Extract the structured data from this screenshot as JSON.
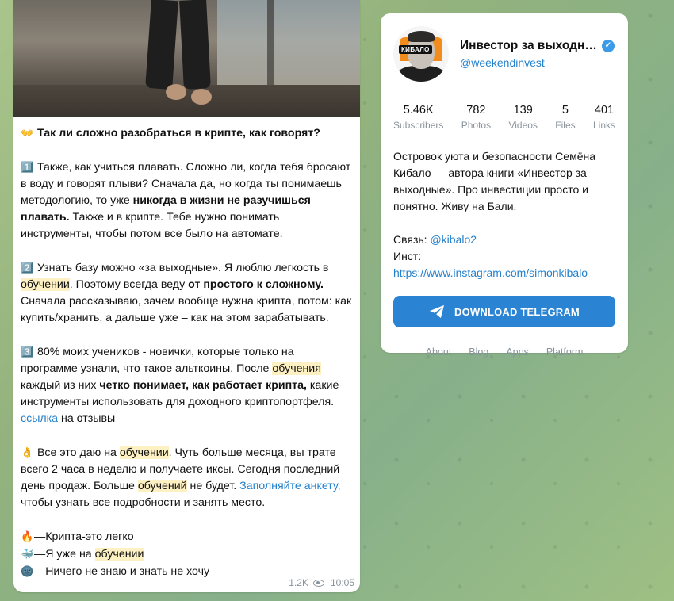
{
  "post": {
    "headline_emoji": "👐",
    "headline": "Так ли сложно разобраться в крипте, как говорят?",
    "p1_emoji": "1️⃣",
    "p1_a": "Также, как учиться плавать. Сложно ли, когда тебя бросают в воду и говорят плыви? Сначала да, но когда ты понимаешь методологию, то уже ",
    "p1_b": "никогда в жизни не разучишься плавать.",
    "p1_c": " Также и в крипте. Тебе нужно понимать инструменты, чтобы потом все было на автомате.",
    "p2_emoji": "2️⃣",
    "p2_a": "Узнать базу можно «за выходные». Я люблю легкость в ",
    "p2_hl": "обучении",
    "p2_b": ". Поэтому всегда веду ",
    "p2_bold": "от простого к сложному.",
    "p2_c": " Сначала рассказываю, зачем вообще нужна крипта, потом: как купить/хранить, а дальше уже – как на этом зарабатывать.",
    "p3_emoji": "3️⃣",
    "p3_a": "80% моих учеников - новички, которые только на программе узнали, что такое альткоины. После ",
    "p3_hl": "обучения",
    "p3_b": " каждый из них ",
    "p3_bold": "четко понимает, как работает крипта,",
    "p3_c": " какие инструменты использовать для доходного криптопортфеля.",
    "p3_link": "ссылка",
    "p3_d": " на отзывы",
    "p4_emoji": "👌",
    "p4_a": "Все это даю на ",
    "p4_hl1": "обучении",
    "p4_b": ". Чуть больше месяца, вы трате всего 2 часа в неделю и получаете иксы. Сегодня последний день продаж. Больше ",
    "p4_hl2": "обучений",
    "p4_c": " не будет. ",
    "p4_link": "Заполняйте анкету,",
    "p4_d": " чтобы узнать все подробности и занять место.",
    "r1_emoji": "🔥",
    "r1": "—Крипта-это легко",
    "r2_emoji": "🐳",
    "r2_a": "—Я уже на ",
    "r2_hl": "обучении",
    "r3_emoji": "🌚",
    "r3": "—Ничего не знаю и знать не хочу",
    "views": "1.2K",
    "time": "10:05"
  },
  "profile": {
    "avatar_brand": "КИБАЛО",
    "title": "Инвестор за выходн…",
    "verified_mark": "✓",
    "username": "@weekendinvest",
    "counters": [
      {
        "value": "5.46K",
        "label": "Subscribers"
      },
      {
        "value": "782",
        "label": "Photos"
      },
      {
        "value": "139",
        "label": "Videos"
      },
      {
        "value": "5",
        "label": "Files"
      },
      {
        "value": "401",
        "label": "Links"
      }
    ],
    "description": "Островок уюта и безопасности Семёна Кибало — автора книги «Инвестор за выходные». Про инвестиции просто и понятно. Живу на Бали.",
    "contact_label": "Связь: ",
    "contact_link": "@kibalo2",
    "insta_label": "Инст:",
    "insta_link": "https://www.instagram.com/simonkibalo",
    "download_label": "DOWNLOAD TELEGRAM",
    "footer": [
      "About",
      "Blog",
      "Apps",
      "Platform"
    ]
  },
  "colors": {
    "accent": "#2a84d3",
    "link": "#2481cc",
    "highlight": "#fdf0c2"
  }
}
